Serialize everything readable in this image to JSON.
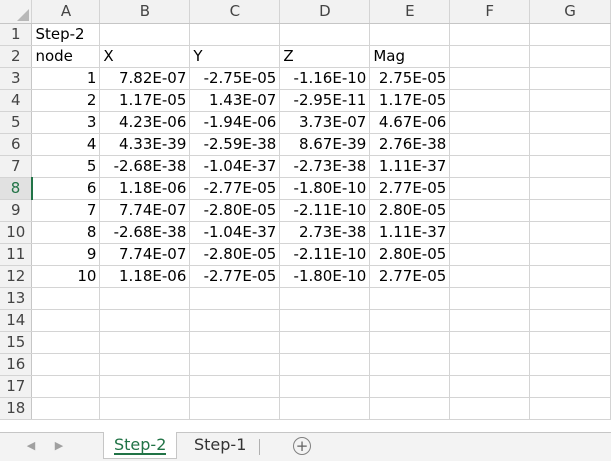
{
  "columns": [
    "A",
    "B",
    "C",
    "D",
    "E",
    "F",
    "G"
  ],
  "rows": [
    {
      "num": "1",
      "cells": [
        "Step-2",
        "",
        "",
        "",
        "",
        "",
        ""
      ]
    },
    {
      "num": "2",
      "cells": [
        "node",
        "X",
        "Y",
        "Z",
        "Mag",
        "",
        ""
      ]
    },
    {
      "num": "3",
      "cells": [
        "1",
        "7.82E-07",
        "-2.75E-05",
        "-1.16E-10",
        "2.75E-05",
        "",
        ""
      ]
    },
    {
      "num": "4",
      "cells": [
        "2",
        "1.17E-05",
        "1.43E-07",
        "-2.95E-11",
        "1.17E-05",
        "",
        ""
      ]
    },
    {
      "num": "5",
      "cells": [
        "3",
        "4.23E-06",
        "-1.94E-06",
        "3.73E-07",
        "4.67E-06",
        "",
        ""
      ]
    },
    {
      "num": "6",
      "cells": [
        "4",
        "4.33E-39",
        "-2.59E-38",
        "8.67E-39",
        "2.76E-38",
        "",
        ""
      ]
    },
    {
      "num": "7",
      "cells": [
        "5",
        "-2.68E-38",
        "-1.04E-37",
        "-2.73E-38",
        "1.11E-37",
        "",
        ""
      ]
    },
    {
      "num": "8",
      "cells": [
        "6",
        "1.18E-06",
        "-2.77E-05",
        "-1.80E-10",
        "2.77E-05",
        "",
        ""
      ]
    },
    {
      "num": "9",
      "cells": [
        "7",
        "7.74E-07",
        "-2.80E-05",
        "-2.11E-10",
        "2.80E-05",
        "",
        ""
      ]
    },
    {
      "num": "10",
      "cells": [
        "8",
        "-2.68E-38",
        "-1.04E-37",
        "2.73E-38",
        "1.11E-37",
        "",
        ""
      ]
    },
    {
      "num": "11",
      "cells": [
        "9",
        "7.74E-07",
        "-2.80E-05",
        "-2.11E-10",
        "2.80E-05",
        "",
        ""
      ]
    },
    {
      "num": "12",
      "cells": [
        "10",
        "1.18E-06",
        "-2.77E-05",
        "-1.80E-10",
        "2.77E-05",
        "",
        ""
      ]
    },
    {
      "num": "13",
      "cells": [
        "",
        "",
        "",
        "",
        "",
        "",
        ""
      ]
    },
    {
      "num": "14",
      "cells": [
        "",
        "",
        "",
        "",
        "",
        "",
        ""
      ]
    },
    {
      "num": "15",
      "cells": [
        "",
        "",
        "",
        "",
        "",
        "",
        ""
      ]
    },
    {
      "num": "16",
      "cells": [
        "",
        "",
        "",
        "",
        "",
        "",
        ""
      ]
    },
    {
      "num": "17",
      "cells": [
        "",
        "",
        "",
        "",
        "",
        "",
        ""
      ]
    },
    {
      "num": "18",
      "cells": [
        "",
        "",
        "",
        "",
        "",
        "",
        ""
      ]
    }
  ],
  "active_row": "8",
  "tabs": {
    "prev_icon": "scroll-left-icon",
    "next_icon": "scroll-right-icon",
    "sheet1": "Step-2",
    "sheet2": "Step-1",
    "add_icon": "plus-circle-icon",
    "add_glyph": "+"
  },
  "colors": {
    "accent": "#217346",
    "gridline": "#d4d4d4",
    "header_bg": "#f2f2f2"
  }
}
